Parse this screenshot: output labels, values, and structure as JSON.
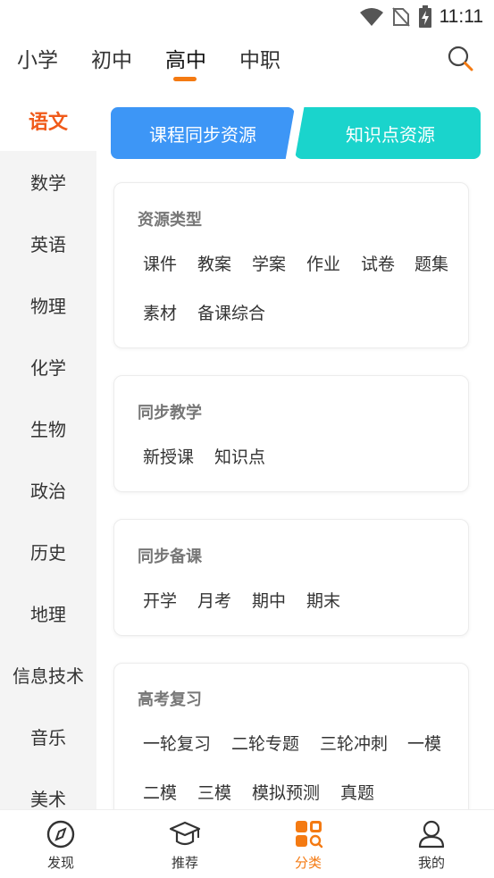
{
  "status_bar": {
    "time": "11:11"
  },
  "level_tabs": [
    "小学",
    "初中",
    "高中",
    "中职"
  ],
  "active_level": "高中",
  "colors": {
    "accent": "#f47a12",
    "active_subject": "#f05a1a",
    "btn_blue": "#3d96f6",
    "btn_teal": "#1ad4cc"
  },
  "sidebar": {
    "active": "语文",
    "items": [
      "语文",
      "数学",
      "英语",
      "物理",
      "化学",
      "生物",
      "政治",
      "历史",
      "地理",
      "信息技术",
      "音乐",
      "美术"
    ]
  },
  "resource_buttons": {
    "sync": "课程同步资源",
    "knowledge": "知识点资源"
  },
  "sections": [
    {
      "title": "资源类型",
      "tags": [
        "课件",
        "教案",
        "学案",
        "作业",
        "试卷",
        "题集",
        "素材",
        "备课综合"
      ]
    },
    {
      "title": "同步教学",
      "tags": [
        "新授课",
        "知识点"
      ]
    },
    {
      "title": "同步备课",
      "tags": [
        "开学",
        "月考",
        "期中",
        "期末"
      ]
    },
    {
      "title": "高考复习",
      "tags": [
        "一轮复习",
        "二轮专题",
        "三轮冲刺",
        "一模",
        "二模",
        "三模",
        "模拟预测",
        "真题"
      ]
    }
  ],
  "bottom_nav": [
    {
      "label": "发现",
      "icon": "compass-icon"
    },
    {
      "label": "推荐",
      "icon": "graduation-cap-icon"
    },
    {
      "label": "分类",
      "icon": "category-grid-icon"
    },
    {
      "label": "我的",
      "icon": "profile-icon"
    }
  ],
  "active_nav": "分类"
}
